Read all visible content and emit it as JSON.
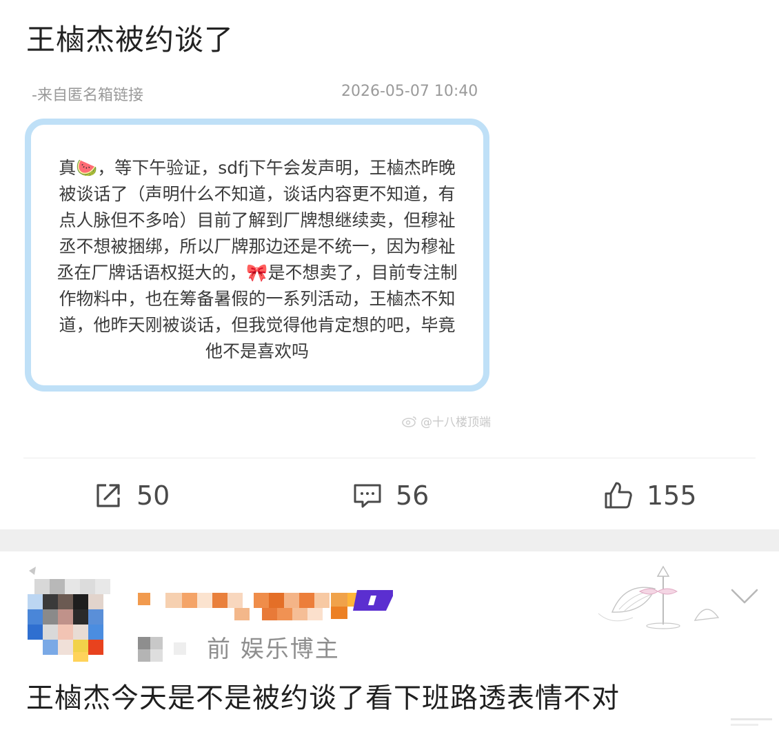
{
  "post": {
    "title": "王樐杰被约谈了",
    "source": "-来自匿名箱链接",
    "timestamp": "2026-05-07 10:40",
    "card_text": "真🍉，等下午验证，sdfj下午会发声明，王樐杰昨晚被谈话了（声明什么不知道，谈话内容更不知道，有点人脉但不多哈）目前了解到厂牌想继续卖，但穆祉丞不想被捆绑，所以厂牌那边还是不统一，因为穆祉丞在厂牌话语权挺大的，🎀是不想卖了，目前专注制作物料中，也在筹备暑假的一系列活动，王樐杰不知道，他昨天刚被谈话，但我觉得他肯定想的吧，毕竟他不是喜欢吗",
    "watermark": "@十八楼顶端"
  },
  "actions": {
    "share_count": "50",
    "comment_count": "56",
    "like_count": "155"
  },
  "comment": {
    "sub_label": "前  娱乐博主",
    "text": "王樐杰今天是不是被约谈了看下班路透表情不对"
  },
  "icons": {
    "share": "share-icon",
    "comment": "comment-icon",
    "like": "thumbs-up-icon",
    "more": "chevron-down-icon",
    "weibo": "weibo-logo-icon"
  },
  "colors": {
    "card_border": "#bfe0f7",
    "band": "#efefef"
  }
}
